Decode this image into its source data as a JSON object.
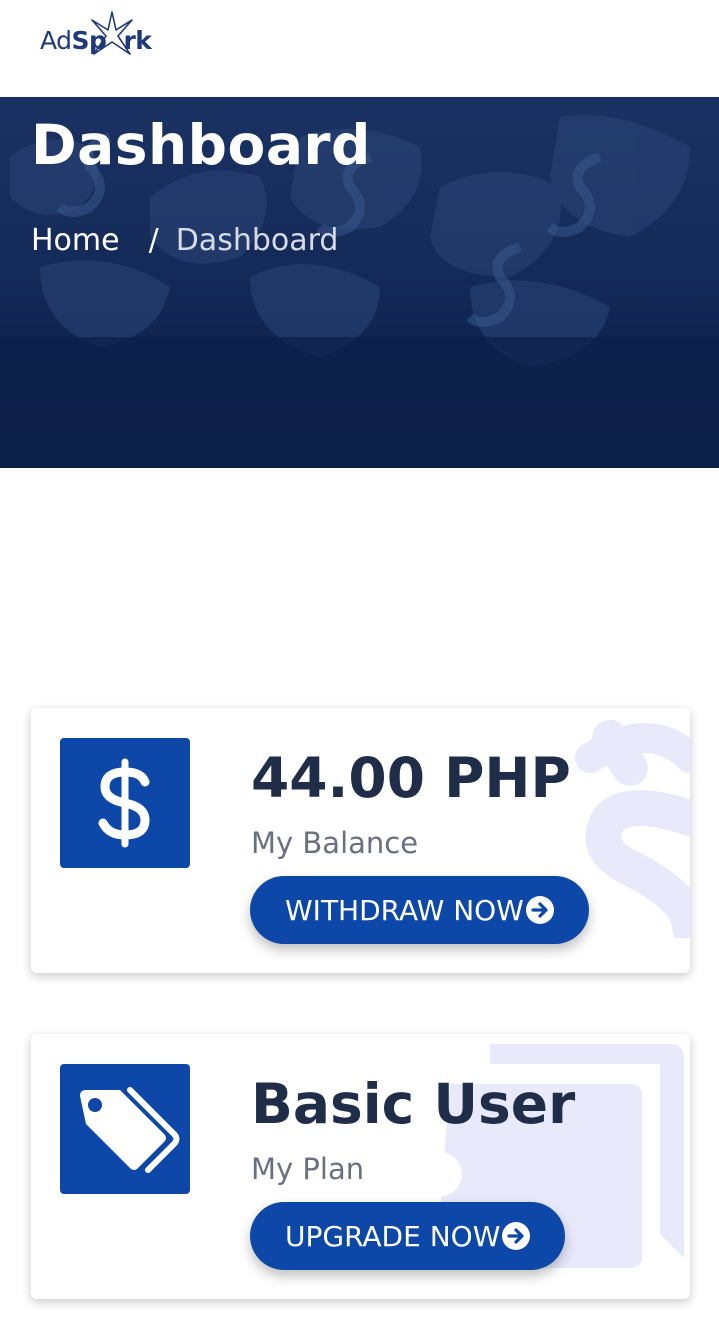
{
  "header": {
    "logo_text_regular": "Ad",
    "logo_text_bold": "Sp",
    "logo_text_tail": "rk"
  },
  "hero": {
    "title": "Dashboard",
    "breadcrumb": {
      "home": "Home",
      "separator": "/",
      "current": "Dashboard"
    }
  },
  "balance_card": {
    "icon": "dollar-icon",
    "value": "44.00 PHP",
    "label": "My Balance",
    "button_label": "WITHDRAW NOW",
    "button_icon": "arrow-circle-right-icon"
  },
  "plan_card": {
    "icon": "tags-icon",
    "value": "Basic User",
    "label": "My Plan",
    "button_label": "UPGRADE NOW",
    "button_icon": "arrow-circle-right-icon"
  },
  "colors": {
    "brand": "#0d47a8",
    "hero_bg": "#142a58",
    "text_dark": "#1f2d48",
    "text_muted": "#6b7080",
    "watermark": "#e8e9fb"
  }
}
